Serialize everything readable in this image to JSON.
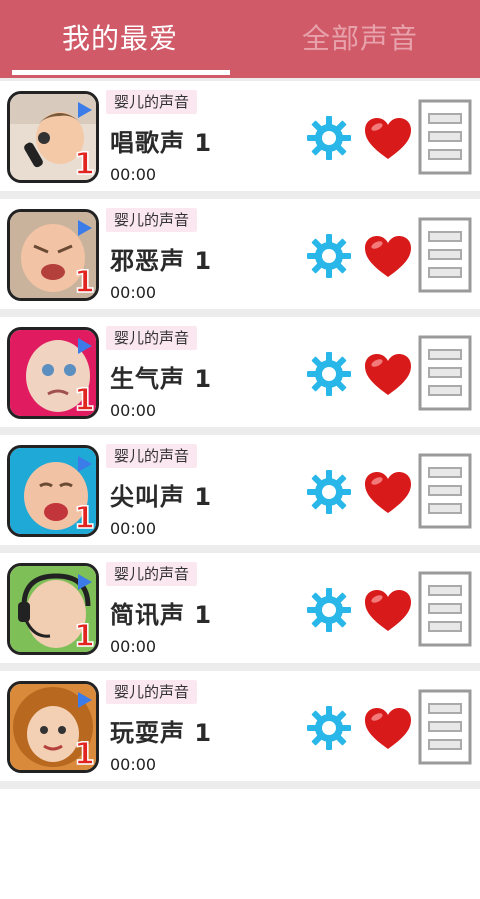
{
  "tabs": [
    {
      "label": "我的最爱",
      "active": true
    },
    {
      "label": "全部声音",
      "active": false
    }
  ],
  "colors": {
    "header_bg": "#d05a68",
    "active_tab_text": "#ffffff",
    "inactive_tab_text": "#e8a2ab",
    "badge_bg": "#fbe7ef",
    "gear": "#29b6e8",
    "heart": "#d91a1a"
  },
  "list": [
    {
      "category": "婴儿的声音",
      "title": "唱歌声 1",
      "duration": "00:00",
      "thumb_number": "1"
    },
    {
      "category": "婴儿的声音",
      "title": "邪恶声 1",
      "duration": "00:00",
      "thumb_number": "1"
    },
    {
      "category": "婴儿的声音",
      "title": "生气声 1",
      "duration": "00:00",
      "thumb_number": "1"
    },
    {
      "category": "婴儿的声音",
      "title": "尖叫声 1",
      "duration": "00:00",
      "thumb_number": "1"
    },
    {
      "category": "婴儿的声音",
      "title": "简讯声 1",
      "duration": "00:00",
      "thumb_number": "1"
    },
    {
      "category": "婴儿的声音",
      "title": "玩耍声 1",
      "duration": "00:00",
      "thumb_number": "1"
    }
  ],
  "icons": {
    "settings": "gear-icon",
    "favorite": "heart-icon",
    "menu": "list-menu-icon",
    "play": "play-icon"
  }
}
